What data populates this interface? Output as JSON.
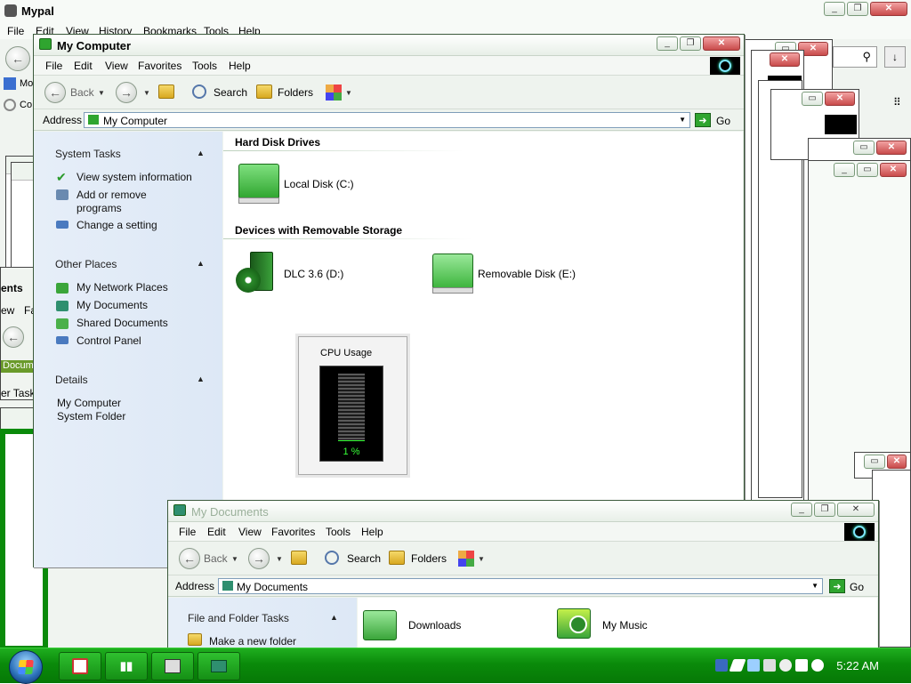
{
  "mypal": {
    "title": "Mypal",
    "menu": [
      "File",
      "Edit",
      "View",
      "History",
      "Bookmarks",
      "Tools",
      "Help"
    ],
    "fragments": {
      "tab1": "Mo",
      "tab2": "Co",
      "stack_title": "ents",
      "stack_view": "ew",
      "stack_fav": "Fa",
      "stack_addr": "Docum",
      "stack_task": "er Task"
    }
  },
  "my_computer": {
    "title": "My Computer",
    "menu": [
      "File",
      "Edit",
      "View",
      "Favorites",
      "Tools",
      "Help"
    ],
    "toolbar": {
      "back": "Back",
      "search": "Search",
      "folders": "Folders"
    },
    "address": {
      "label": "Address",
      "value": "My Computer",
      "go": "Go"
    },
    "system_tasks": {
      "header": "System Tasks",
      "items": [
        "View system information",
        "Add or remove programs",
        "Change a setting"
      ]
    },
    "other_places": {
      "header": "Other Places",
      "items": [
        "My Network Places",
        "My Documents",
        "Shared Documents",
        "Control Panel"
      ]
    },
    "details": {
      "header": "Details",
      "name": "My Computer",
      "type": "System Folder"
    },
    "sections": {
      "hard_disk": "Hard Disk Drives",
      "removable": "Devices with Removable Storage"
    },
    "drives": {
      "c": "Local Disk (C:)",
      "d": "DLC 3.6 (D:)",
      "e": "Removable Disk (E:)"
    }
  },
  "cpu_gadget": {
    "title": "CPU Usage",
    "value_text": "1 %",
    "usage_fraction": 0.01,
    "accent": "#37ff37"
  },
  "my_documents": {
    "title": "My Documents",
    "menu": [
      "File",
      "Edit",
      "View",
      "Favorites",
      "Tools",
      "Help"
    ],
    "toolbar": {
      "back": "Back",
      "search": "Search",
      "folders": "Folders"
    },
    "address": {
      "label": "Address",
      "value": "My Documents",
      "go": "Go"
    },
    "tasks": {
      "header": "File and Folder Tasks",
      "item1": "Make a new folder"
    },
    "items": [
      "Downloads",
      "My Music"
    ]
  },
  "taskbar": {
    "clock": "5:22 AM",
    "accent": "#0a8a0a"
  }
}
